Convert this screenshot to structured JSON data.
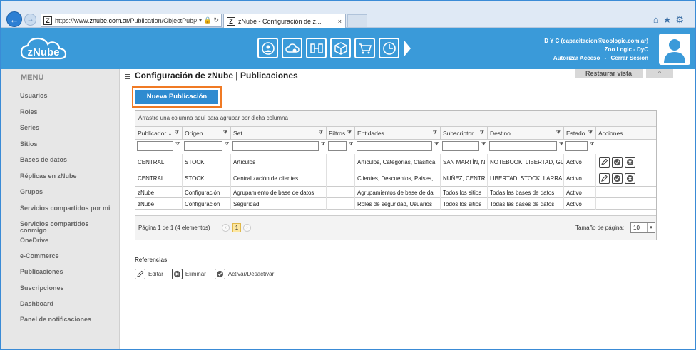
{
  "browser": {
    "url_prefix": "https://www.",
    "url_domain": "znube.com.ar",
    "url_path": "/Publication/ObjectPubl",
    "url_tools": "ρ ▾ 🔒 ↻",
    "tab_title": "zNube - Configuración de z...",
    "tab_close": "×",
    "favicon": "Z"
  },
  "header": {
    "logo_text": "zNube",
    "user_line": "D Y C (capacitacion@zoologic.com.ar)",
    "company_line": "Zoo Logic - DyC",
    "authorize_label": "Autorizar Acceso",
    "separator": "-",
    "logout_label": "Cerrar Sesión",
    "module_icons": [
      "users-gear-icon",
      "cloud-gear-icon",
      "flow-icon",
      "box-icon",
      "cart-icon",
      "clock-icon"
    ]
  },
  "sidebar": {
    "title": "MENÚ",
    "items": [
      {
        "label": "Usuarios"
      },
      {
        "label": "Roles"
      },
      {
        "label": "Series"
      },
      {
        "label": "Sitios"
      },
      {
        "label": "Bases de datos"
      },
      {
        "label": "Réplicas en zNube"
      },
      {
        "label": "Grupos"
      },
      {
        "label": "Servicios compartidos por mi"
      },
      {
        "label": "Servicios compartidos"
      },
      {
        "label": "conmigo"
      },
      {
        "label": "OneDrive"
      },
      {
        "label": "e-Commerce"
      },
      {
        "label": "Publicaciones"
      },
      {
        "label": "Suscripciones"
      },
      {
        "label": "Dashboard"
      },
      {
        "label": "Panel de notificaciones"
      }
    ]
  },
  "page": {
    "title": "Configuración de zNube | Publicaciones",
    "restore_label": "Restaurar vista",
    "collapse_label": "^",
    "new_button": "Nueva Publicación"
  },
  "grid": {
    "group_hint": "Arrastre una columna aquí para agrupar por dicha columna",
    "columns": [
      "Publicador",
      "Origen",
      "Set",
      "Filtros",
      "Entidades",
      "Subscriptor",
      "Destino",
      "Estado",
      "Acciones"
    ],
    "sort_indicator": "▲",
    "filter_glyph": "⧩",
    "rows": [
      [
        "CENTRAL",
        "STOCK",
        "Artículos",
        "",
        "Artículos, Categorías, Clasifica",
        "SAN MARTÍN, N",
        "NOTEBOOK, LIBERTAD, GU",
        "Activo"
      ],
      [
        "CENTRAL",
        "STOCK",
        "Centralización de clientes",
        "",
        "Clientes, Descuentos, Paises,",
        "NUÑEZ, CENTR",
        "LIBERTAD, STOCK, LARRA",
        "Activo"
      ],
      [
        "zNube",
        "Configuración",
        "Agrupamiento de base de datos",
        "",
        "Agrupamientos de base de da",
        "Todos los sitios",
        "Todas las bases de datos",
        "Activo"
      ],
      [
        "zNube",
        "Configuración",
        "Seguridad",
        "",
        "Roles de seguridad, Usuarios",
        "Todos los sitios",
        "Todas las bases de datos",
        "Activo"
      ]
    ],
    "pager_text": "Página 1 de 1 (4 elementos)",
    "prev": "‹",
    "next": "›",
    "current_page": "1",
    "page_size_label": "Tamaño de página:",
    "page_size": "10",
    "page_size_dd": "▾"
  },
  "references": {
    "title": "Referencias",
    "edit": "Editar",
    "delete": "Eliminar",
    "toggle": "Activar/Desactivar"
  },
  "colors": {
    "header_blue": "#3a9ad9",
    "button_blue": "#2f8bd0",
    "highlight_orange": "#f07a24",
    "sidebar_bg": "#e7e7e7"
  }
}
